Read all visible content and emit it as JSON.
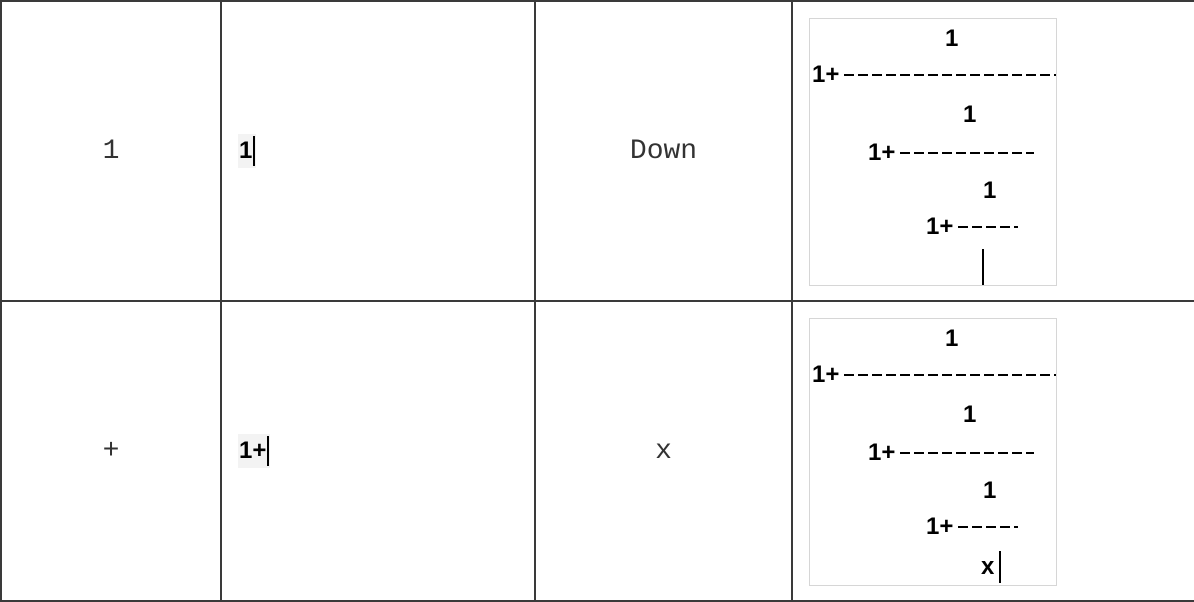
{
  "rows": [
    {
      "key": "1",
      "typed": "1",
      "next_key": "Down",
      "result": {
        "n1": "1",
        "d1": "1+",
        "n2": "1",
        "d2": "1+",
        "n3": "1",
        "d3": "1+",
        "tail": ""
      }
    },
    {
      "key": "+",
      "typed": "1+",
      "next_key": "x",
      "result": {
        "n1": "1",
        "d1": "1+",
        "n2": "1",
        "d2": "1+",
        "n3": "1",
        "d3": "1+",
        "tail": "x"
      }
    }
  ]
}
